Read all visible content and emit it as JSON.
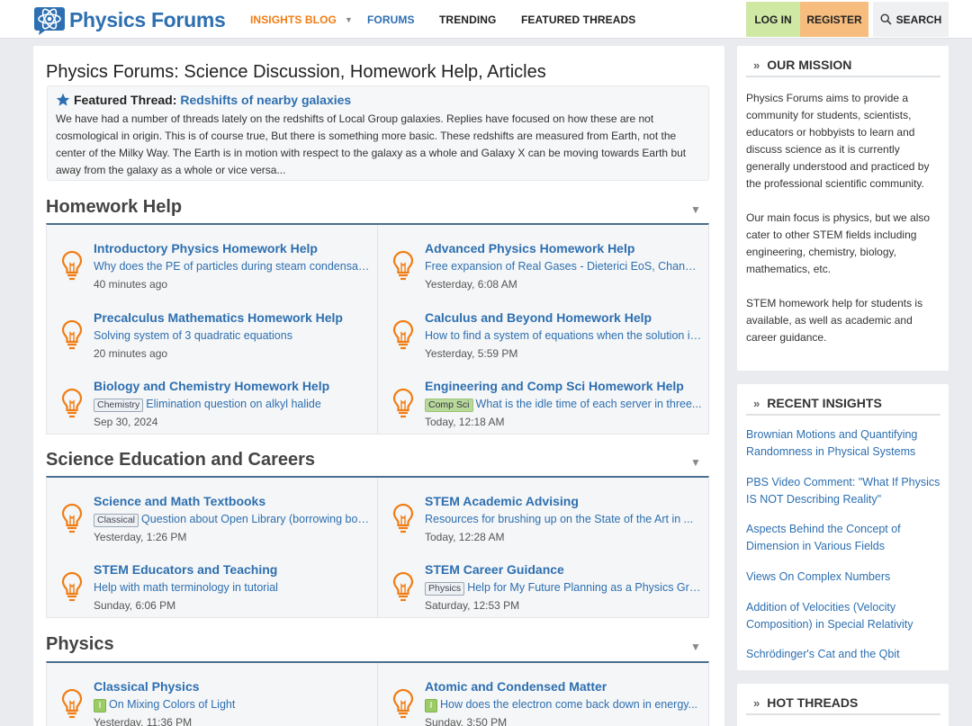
{
  "brand": {
    "name_a": "Physics ",
    "name_b": "Forums"
  },
  "nav": {
    "insights": "INSIGHTS BLOG",
    "forums": "FORUMS",
    "trending": "TRENDING",
    "featured": "FEATURED THREADS",
    "login": "LOG IN",
    "register": "REGISTER",
    "search": "SEARCH"
  },
  "main": {
    "title": "Physics Forums: Science Discussion, Homework Help, Articles",
    "featured": {
      "label": "Featured Thread:",
      "link": "Redshifts of nearby galaxies",
      "body": "We have had a number of threads lately on the redshifts of Local Group galaxies. Replies have focused on how these are not cosmological in origin. This is of course true, But there is something more basic. These redshifts are measured from Earth, not the center of the Milky Way. The Earth is in motion with respect to the galaxy as a whole and Galaxy X can be moving towards Earth but away from the galaxy as a whole or vice versa..."
    },
    "sections": [
      {
        "title": "Homework Help",
        "nodes": [
          {
            "title": "Introductory Physics Homework Help",
            "tag": "",
            "thread": "Why does the PE of particles during steam condensation...",
            "time": "40 minutes ago"
          },
          {
            "title": "Advanced Physics Homework Help",
            "tag": "",
            "thread": "Free expansion of Real Gases - Dieterici EoS, Change in...",
            "time": "Yesterday, 6:08 AM"
          },
          {
            "title": "Precalculus Mathematics Homework Help",
            "tag": "",
            "thread": "Solving system of 3 quadratic equations",
            "time": "20 minutes ago"
          },
          {
            "title": "Calculus and Beyond Homework Help",
            "tag": "",
            "thread": "How to find a system of equations when the solution is...",
            "time": "Yesterday, 5:59 PM"
          },
          {
            "title": "Biology and Chemistry Homework Help",
            "tag": "Chemistry",
            "thread": "Elimination question on alkyl halide",
            "time": "Sep 30, 2024"
          },
          {
            "title": "Engineering and Comp Sci Homework Help",
            "tag": "Comp Sci",
            "thread": "What is the idle time of each server in three...",
            "time": "Today, 12:18 AM"
          }
        ]
      },
      {
        "title": "Science Education and Careers",
        "nodes": [
          {
            "title": "Science and Math Textbooks",
            "tag": "Classical",
            "thread": "Question about Open Library (borrowing books)",
            "time": "Yesterday, 1:26 PM"
          },
          {
            "title": "STEM Academic Advising",
            "tag": "",
            "thread": "Resources for brushing up on the State of the Art in ...",
            "time": "Today, 12:28 AM"
          },
          {
            "title": "STEM Educators and Teaching",
            "tag": "",
            "thread": "Help with math terminology in tutorial",
            "time": "Sunday, 6:06 PM"
          },
          {
            "title": "STEM Career Guidance",
            "tag": "Physics",
            "thread": "Help for My Future Planning as a Physics Graduate",
            "time": "Saturday, 12:53 PM"
          }
        ]
      },
      {
        "title": "Physics",
        "nodes": [
          {
            "title": "Classical Physics",
            "tag": "I",
            "thread": "On Mixing Colors of Light",
            "time": "Yesterday, 11:36 PM"
          },
          {
            "title": "Atomic and Condensed Matter",
            "tag": "I",
            "thread": "How does the electron come back down in energy...",
            "time": "Sunday, 3:50 PM"
          }
        ]
      }
    ]
  },
  "sidebar": {
    "mission": {
      "title": "OUR MISSION",
      "p1": "Physics Forums aims to provide a community for students, scientists, educators or hobbyists to learn and discuss science as it is currently generally understood and practiced by the professional scientific community.",
      "p2": "Our main focus is physics, but we also cater to other STEM fields including engineering, chemistry, biology, mathematics, etc.",
      "p3": "STEM homework help for students is available, as well as academic and career guidance."
    },
    "insights": {
      "title": "RECENT INSIGHTS",
      "items": [
        "Brownian Motions and Quantifying Randomness in Physical Systems",
        "PBS Video Comment: \"What If Physics IS NOT Describing Reality\"",
        "Aspects Behind the Concept of Dimension in Various Fields",
        "Views On Complex Numbers",
        "Addition of Velocities (Velocity Composition) in Special Relativity",
        "Schrödinger's Cat and the Qbit"
      ]
    },
    "hot": {
      "title": "HOT THREADS"
    }
  },
  "colors": {
    "brand_blue": "#2d6fb0",
    "insights_orange": "#f07d14",
    "login_bg": "#cfe9a5",
    "register_bg": "#f6bd7e",
    "bulb": "#f07d14"
  },
  "icons": [
    "atom-logo-icon",
    "search-icon",
    "star-icon",
    "lightbulb-icon",
    "chevron-down-icon",
    "chevron-right-icon"
  ]
}
